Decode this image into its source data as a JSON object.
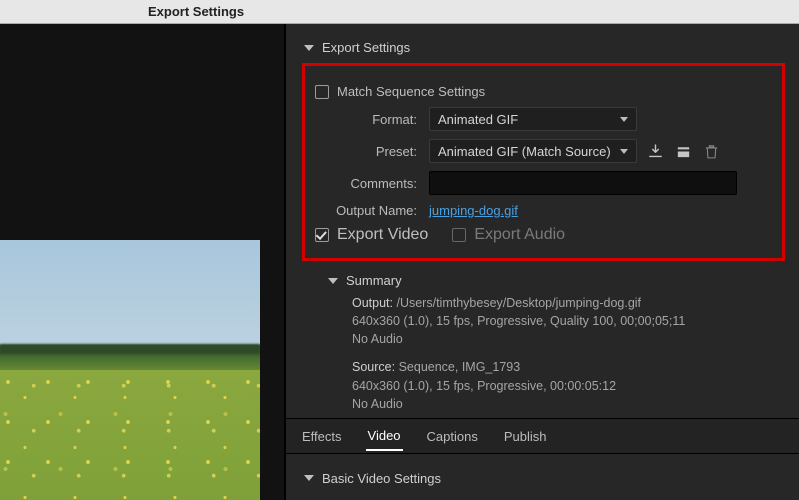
{
  "window": {
    "title": "Export Settings"
  },
  "sections": {
    "export_settings": "Export Settings",
    "summary": "Summary",
    "basic_video": "Basic Video Settings"
  },
  "export": {
    "match_sequence_label": "Match Sequence Settings",
    "match_sequence_checked": false,
    "format_label": "Format:",
    "format_value": "Animated GIF",
    "preset_label": "Preset:",
    "preset_value": "Animated GIF (Match Source)",
    "comments_label": "Comments:",
    "comments_value": "",
    "output_name_label": "Output Name:",
    "output_name_value": "jumping-dog.gif",
    "export_video_label": "Export Video",
    "export_video_checked": true,
    "export_audio_label": "Export Audio",
    "export_audio_checked": false
  },
  "summary": {
    "output_label": "Output:",
    "output_path": "/Users/timthybesey/Desktop/jumping-dog.gif",
    "output_line2": "640x360 (1.0), 15 fps, Progressive, Quality 100, 00;00;05;11",
    "output_line3": "No Audio",
    "source_label": "Source:",
    "source_line1": "Sequence, IMG_1793",
    "source_line2": "640x360 (1.0), 15 fps, Progressive, 00:00:05:12",
    "source_line3": "No Audio"
  },
  "tabs": {
    "effects": "Effects",
    "video": "Video",
    "captions": "Captions",
    "publish": "Publish",
    "active": "video"
  }
}
